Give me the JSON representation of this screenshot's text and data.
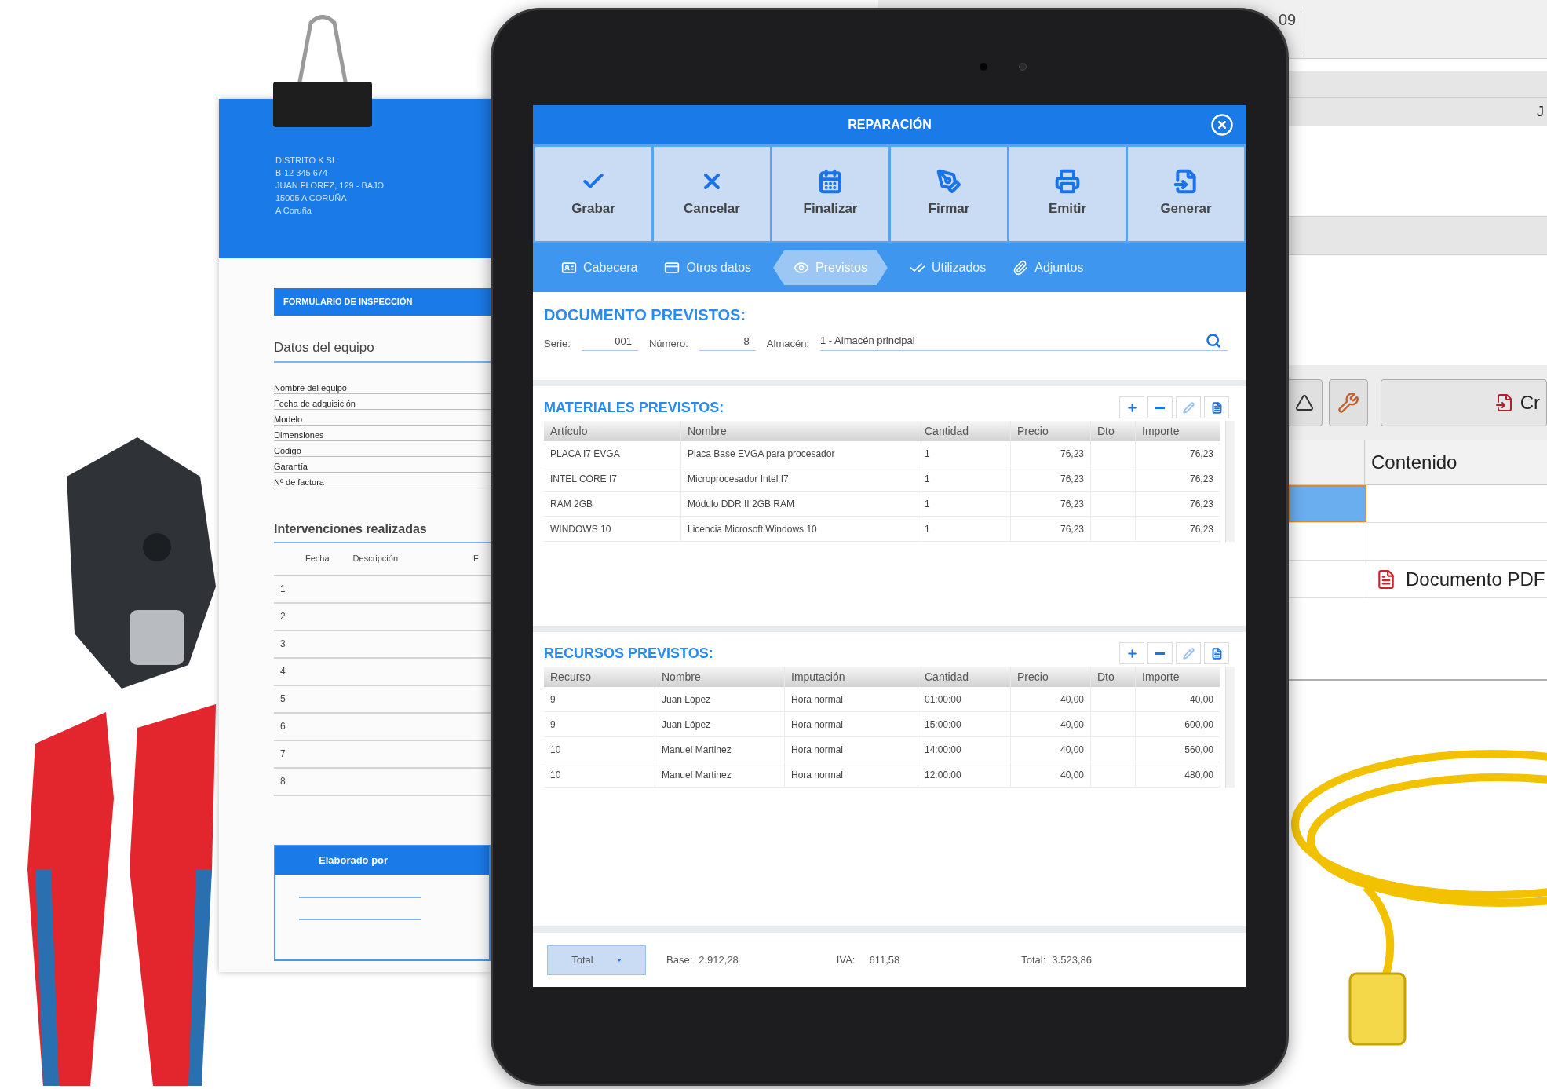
{
  "clipboard": {
    "company_lines": [
      "DISTRITO K SL",
      "B-12 345 674",
      "JUAN FLOREZ, 129 - BAJO",
      "15005  A CORUÑA",
      "A Coruña"
    ],
    "form_title": "FORMULARIO DE INSPECCIÓN",
    "equipment_section": {
      "title": "Datos del equipo",
      "fields": [
        "Nombre del equipo",
        "Fecha de adquisición",
        "Modelo",
        "Dimensiones",
        "Codigo",
        "Garantía",
        "Nº de factura"
      ]
    },
    "interventions_section": {
      "title": "Intervenciones realizadas",
      "columns": [
        "Fecha",
        "Descripción",
        "F"
      ],
      "row_numbers": [
        "1",
        "2",
        "3",
        "4",
        "5",
        "6",
        "7",
        "8"
      ]
    },
    "signature_section": {
      "title": "Elaborado por"
    }
  },
  "background_window": {
    "top_text": "09",
    "cell_text": "J",
    "button_label": "Cr",
    "column_header": "Contenido",
    "rows": [
      {
        "selected": true
      },
      {
        "selected": false
      },
      {
        "selected": false,
        "content": "Documento PDF"
      }
    ]
  },
  "app": {
    "title": "REPARACIÓN",
    "toolbar": [
      "Grabar",
      "Cancelar",
      "Finalizar",
      "Firmar",
      "Emitir",
      "Generar"
    ],
    "tabs": [
      {
        "label": "Cabecera",
        "selected": false
      },
      {
        "label": "Otros datos",
        "selected": false
      },
      {
        "label": "Previstos",
        "selected": true
      },
      {
        "label": "Utilizados",
        "selected": false
      },
      {
        "label": "Adjuntos",
        "selected": false
      }
    ],
    "documento": {
      "title": "DOCUMENTO PREVISTOS:",
      "fields": [
        {
          "label": "Serie:",
          "value": "001"
        },
        {
          "label": "Número:",
          "value": "8"
        },
        {
          "label": "Almacén:",
          "value": "1 - Almacén principal"
        }
      ]
    },
    "materiales": {
      "title": "MATERIALES PREVISTOS:",
      "columns": [
        "Artículo",
        "Nombre",
        "Cantidad",
        "Precio",
        "Dto",
        "Importe"
      ],
      "rows": [
        [
          "PLACA I7 EVGA",
          "Placa Base EVGA para procesador",
          "1",
          "76,23",
          "",
          "76,23"
        ],
        [
          "INTEL CORE I7",
          "Microprocesador Intel I7",
          "1",
          "76,23",
          "",
          "76,23"
        ],
        [
          "RAM 2GB",
          "Módulo DDR II 2GB RAM",
          "1",
          "76,23",
          "",
          "76,23"
        ],
        [
          "WINDOWS 10",
          "Licencia Microsoft Windows 10",
          "1",
          "76,23",
          "",
          "76,23"
        ]
      ]
    },
    "recursos": {
      "title": "RECURSOS PREVISTOS:",
      "columns": [
        "Recurso",
        "Nombre",
        "Imputación",
        "Cantidad",
        "Precio",
        "Dto",
        "Importe"
      ],
      "rows": [
        [
          "9",
          "Juan López",
          "Hora normal",
          "01:00:00",
          "40,00",
          "",
          "40,00"
        ],
        [
          "9",
          "Juan López",
          "Hora normal",
          "15:00:00",
          "40,00",
          "",
          "600,00"
        ],
        [
          "10",
          "Manuel Martinez",
          "Hora normal",
          "14:00:00",
          "40,00",
          "",
          "560,00"
        ],
        [
          "10",
          "Manuel Martinez",
          "Hora normal",
          "12:00:00",
          "40,00",
          "",
          "480,00"
        ]
      ]
    },
    "footer": {
      "total_button": "Total",
      "base": {
        "label": "Base:",
        "value": "2.912,28"
      },
      "iva": {
        "label": "IVA:",
        "value": "611,58"
      },
      "total": {
        "label": "Total:",
        "value": "3.523,86"
      }
    }
  }
}
